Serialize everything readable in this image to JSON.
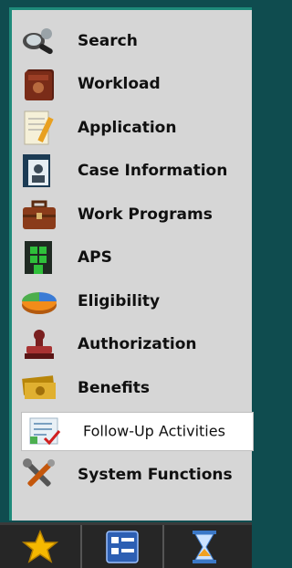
{
  "menu": {
    "items": [
      {
        "label": "Search",
        "icon": "search-icon"
      },
      {
        "label": "Workload",
        "icon": "book-icon"
      },
      {
        "label": "Application",
        "icon": "document-pencil-icon"
      },
      {
        "label": "Case Information",
        "icon": "id-card-icon"
      },
      {
        "label": "Work Programs",
        "icon": "briefcase-icon"
      },
      {
        "label": "APS",
        "icon": "building-icon"
      },
      {
        "label": "Eligibility",
        "icon": "pie-chart-icon"
      },
      {
        "label": "Authorization",
        "icon": "stamp-icon"
      },
      {
        "label": "Benefits",
        "icon": "money-icon"
      },
      {
        "label": "Follow-Up Activities",
        "icon": "checklist-icon",
        "selected": true
      },
      {
        "label": "System Functions",
        "icon": "tools-icon"
      }
    ]
  },
  "bottombar": {
    "tabs": [
      {
        "icon": "star-icon"
      },
      {
        "icon": "list-icon"
      },
      {
        "icon": "hourglass-icon"
      }
    ]
  },
  "colors": {
    "frame": "#0f4c4f",
    "panel": "#d6d6d6",
    "accent_border": "#1e8a7a",
    "selected_bg": "#ffffff"
  }
}
